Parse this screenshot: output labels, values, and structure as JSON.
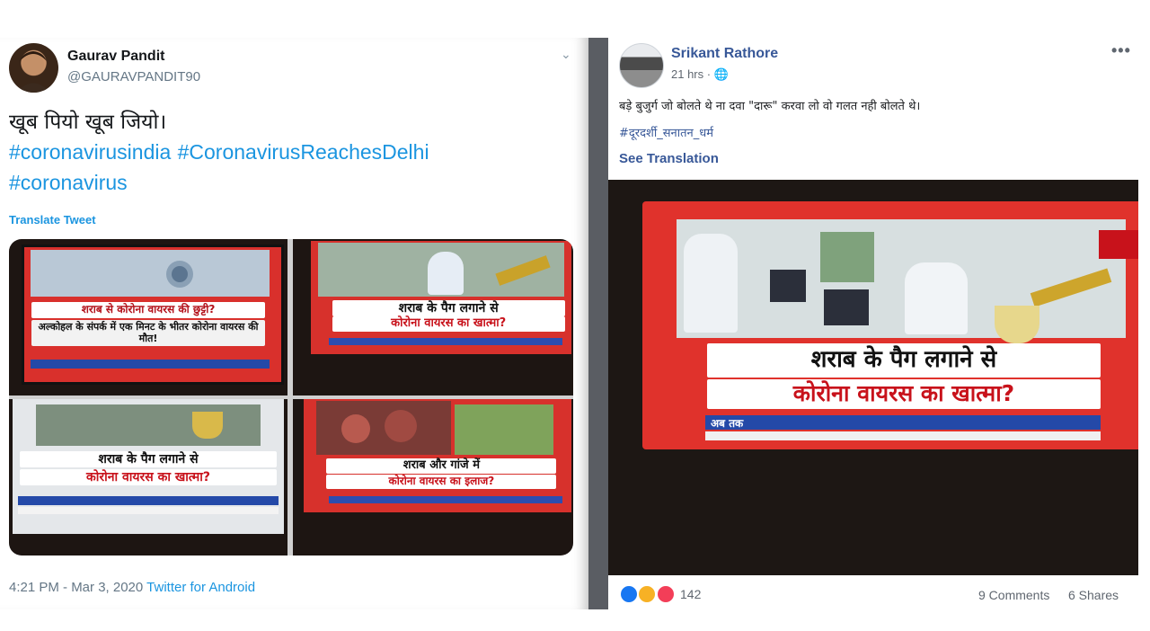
{
  "twitter": {
    "name": "Gaurav Pandit",
    "handle": "@GAURAVPANDIT90",
    "text": "खूब पियो खूब जियो।",
    "hashtags": [
      "#coronavirusindia",
      "#CoronavirusReachesDelhi",
      "#coronavirus"
    ],
    "translate_label": "Translate Tweet",
    "images": [
      {
        "line1": "शराब से कोरोना वायरस की छुट्टी?",
        "line2": "अल्कोहल के संपर्क में एक मिनट के भीतर कोरोना वायरस की मौत!"
      },
      {
        "line1": "शराब के पैग लगाने से",
        "line2": "कोरोना वायरस का खात्मा?"
      },
      {
        "line1": "शराब के पैग लगाने से",
        "line2": "कोरोना वायरस का खात्मा?"
      },
      {
        "line1": "शराब और गांजे में",
        "line2": "कोरोना वायरस का इलाज?"
      }
    ],
    "timestamp": "4:21 PM - Mar 3, 2020",
    "source": "Twitter for Android",
    "colors": {
      "link": "#1b95e0",
      "text": "#14171a",
      "muted": "#657786"
    }
  },
  "facebook": {
    "name": "Srikant Rathore",
    "time": "21 hrs ·",
    "text": "बड़े बुजुर्ग जो बोलते थे ना दवा \"दारू\" करवा लो वो गलत नही बोलते थे।",
    "hashtag": "#दूरदर्शी_सनातन_धर्म",
    "see_translation": "See Translation",
    "image": {
      "line1": "शराब के पैग लगाने से",
      "line2": "कोरोना वायरस का खात्मा?",
      "ticker": "अब तक"
    },
    "reactions": [
      "like",
      "haha",
      "love"
    ],
    "reaction_count": "142",
    "comments": "9 Comments",
    "shares": "6 Shares",
    "colors": {
      "link": "#385898",
      "muted": "#606770"
    }
  }
}
